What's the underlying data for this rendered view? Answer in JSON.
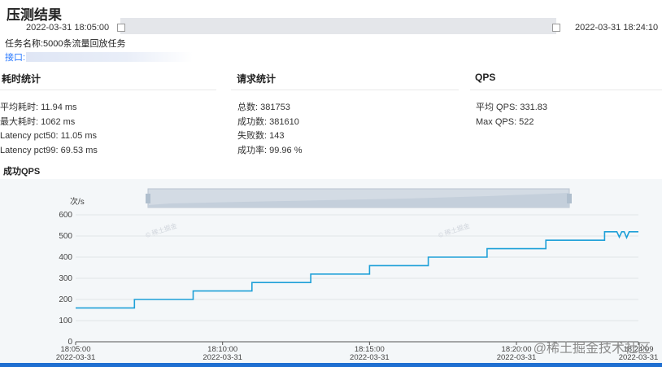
{
  "header": {
    "title": "压测结果",
    "time_start": "2022-03-31 18:05:00",
    "time_end": "2022-03-31 18:24:10"
  },
  "task": {
    "label": "任务名称:5000条流量回放任务"
  },
  "interface": {
    "label": "接口:"
  },
  "sections": {
    "latency": {
      "title": "耗时统计",
      "items": [
        "平均耗时: 11.94 ms",
        "最大耗时: 1062 ms",
        "Latency pct50: 11.05 ms",
        "Latency pct99: 69.53 ms"
      ]
    },
    "requests": {
      "title": "请求统计",
      "items": [
        "总数: 381753",
        "成功数: 381610",
        "失败数: 143",
        "成功率: 99.96 %"
      ]
    },
    "qps": {
      "title": "QPS",
      "items": [
        "平均 QPS: 331.83",
        "Max QPS: 522"
      ]
    }
  },
  "chart_title": "成功QPS",
  "watermark": "@稀土掘金技术社区",
  "chart_data": {
    "type": "line",
    "ylabel": "次/s",
    "ylim": [
      0,
      600
    ],
    "yticks": [
      "0",
      "100",
      "200",
      "300",
      "400",
      "500",
      "600"
    ],
    "xticks": [
      {
        "time": "18:05:00",
        "date": "2022-03-31"
      },
      {
        "time": "18:10:00",
        "date": "2022-03-31"
      },
      {
        "time": "18:15:00",
        "date": "2022-03-31"
      },
      {
        "time": "18:20:00",
        "date": "2022-03-31"
      },
      {
        "time": "18:24:09",
        "date": "2022-03-31"
      }
    ],
    "series": [
      {
        "color": "#1ea0d8",
        "x": [
          "18:05:00",
          "18:07:00",
          "18:07:00",
          "18:09:00",
          "18:09:00",
          "18:11:00",
          "18:11:00",
          "18:13:00",
          "18:13:00",
          "18:15:00",
          "18:15:00",
          "18:17:00",
          "18:17:00",
          "18:19:00",
          "18:19:00",
          "18:21:00",
          "18:21:00",
          "18:23:00",
          "18:23:00",
          "18:23:25",
          "18:23:30",
          "18:23:35",
          "18:23:40",
          "18:23:45",
          "18:23:50",
          "18:24:09"
        ],
        "y": [
          160,
          160,
          200,
          200,
          240,
          240,
          280,
          280,
          320,
          320,
          360,
          360,
          400,
          400,
          440,
          440,
          480,
          480,
          520,
          520,
          495,
          520,
          520,
          492,
          520,
          520
        ]
      }
    ]
  }
}
